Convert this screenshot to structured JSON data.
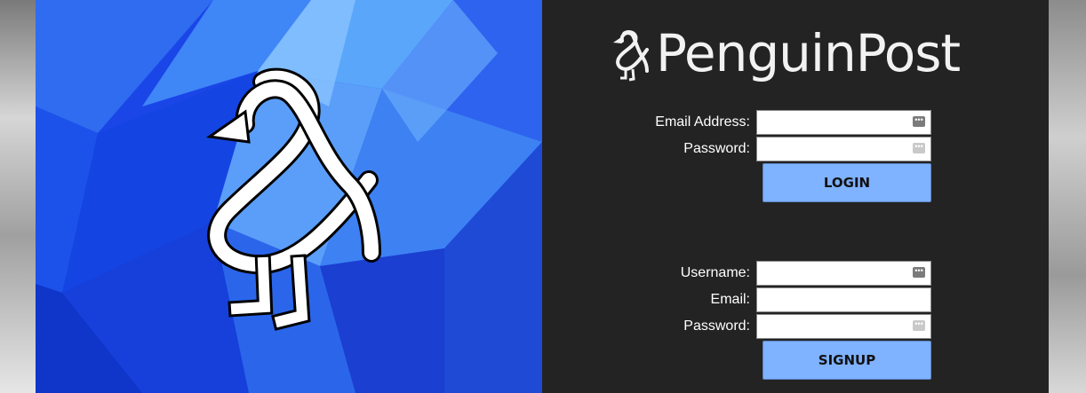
{
  "brand": {
    "name": "PenguinPost",
    "logo_icon": "penguin-ampersand-icon"
  },
  "login": {
    "email_label": "Email Address:",
    "email_value": "",
    "password_label": "Password:",
    "password_value": "",
    "button_label": "LOGIN"
  },
  "signup": {
    "username_label": "Username:",
    "username_value": "",
    "email_label": "Email:",
    "email_value": "",
    "password_label": "Password:",
    "password_value": "",
    "button_label": "SIGNUP"
  },
  "colors": {
    "panel_bg": "#232323",
    "button_bg": "#7fb2ff",
    "hero_blue": "#1a46e8"
  },
  "icons": {
    "field_key_icon": "password-manager-key-icon"
  }
}
